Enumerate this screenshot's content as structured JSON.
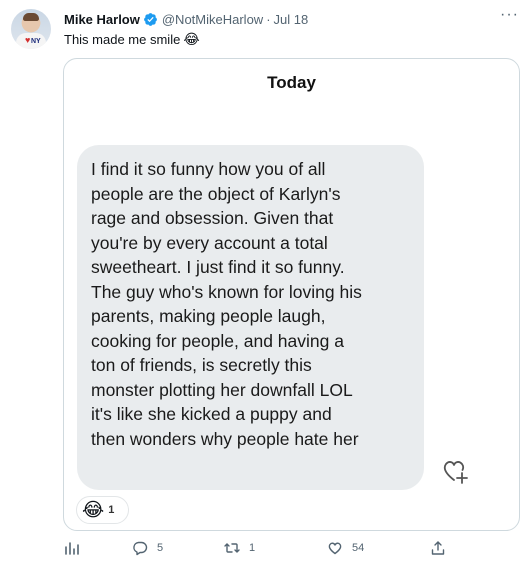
{
  "tweet": {
    "author_name": "Mike Harlow",
    "handle": "@NotMikeHarlow",
    "separator": "·",
    "date": "Jul 18",
    "text": "This made me smile",
    "text_emoji": "😂",
    "more_label": "···"
  },
  "media": {
    "title": "Today",
    "message": "I find it so funny how you of all\npeople are the object of Karlyn's\nrage and obsession. Given that\nyou're by every account a total\nsweetheart. I just find it so funny.\nThe guy who's known for loving his\nparents, making people laugh,\ncooking for people, and having a\nton of friends, is secretly this\nmonster plotting her downfall LOL\nit's like she kicked a puppy and\nthen wonders why people hate her",
    "reaction_emoji": "😂",
    "reaction_count": "1"
  },
  "actions": {
    "analytics": {
      "icon": "bar-chart-icon",
      "count": ""
    },
    "reply": {
      "icon": "speech-bubble-icon",
      "count": "5"
    },
    "retweet": {
      "icon": "retweet-arrows-icon",
      "count": "1"
    },
    "like": {
      "icon": "heart-icon",
      "count": "54"
    },
    "share": {
      "icon": "share-upload-icon",
      "count": ""
    }
  },
  "colors": {
    "verified_blue": "#1d9bf0",
    "muted_text": "#536471",
    "bubble_gray": "#e9ecee",
    "border": "#cfd9de"
  }
}
